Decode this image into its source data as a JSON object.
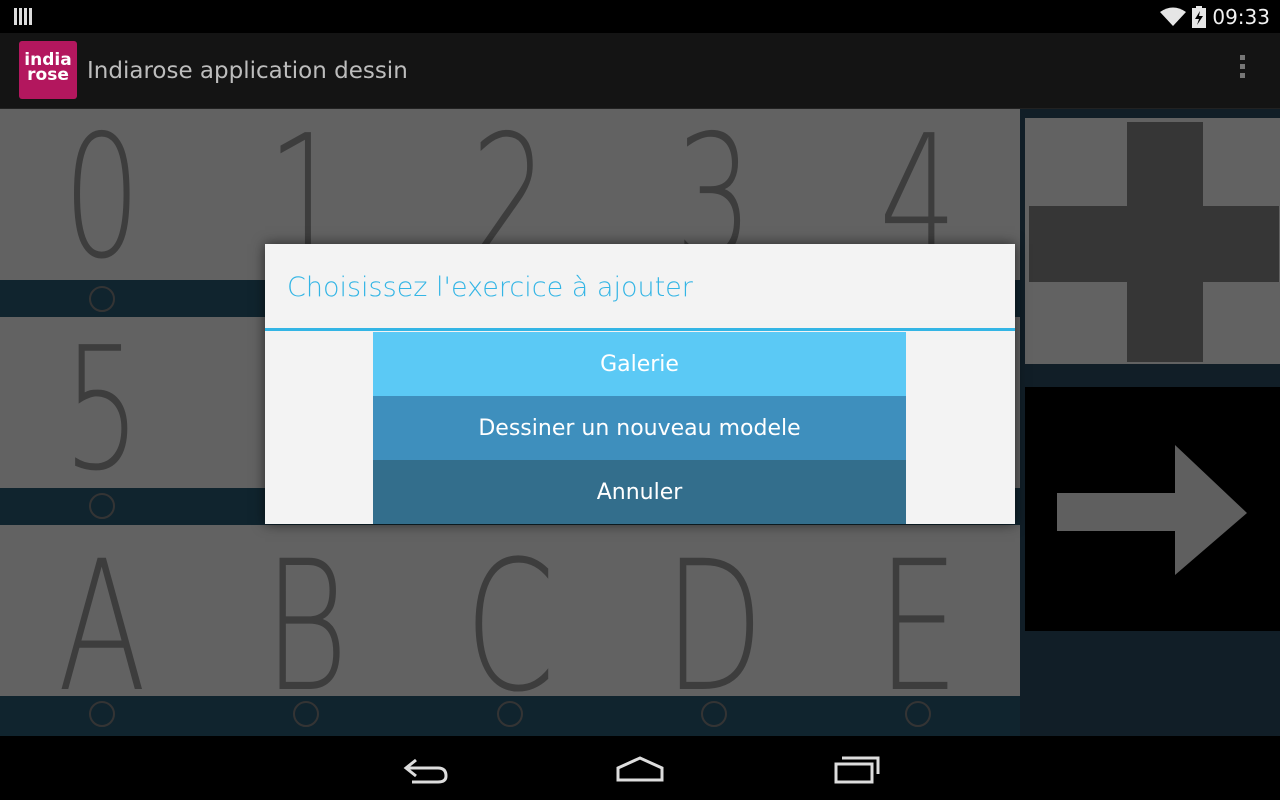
{
  "status_bar": {
    "time": "09:33",
    "icons": [
      "notification-icon",
      "wifi-icon",
      "battery-charging-icon"
    ]
  },
  "action_bar": {
    "app_icon_text_line1": "india",
    "app_icon_text_line2": "rose",
    "title": "Indiarose application dessin",
    "overflow_icon": "overflow-menu-icon"
  },
  "grid": {
    "rows": [
      {
        "items": [
          "0",
          "1",
          "2",
          "3",
          "4"
        ]
      },
      {
        "items": [
          "5",
          "",
          "",
          "",
          ""
        ]
      },
      {
        "items": [
          "A",
          "B",
          "C",
          "D",
          "E"
        ]
      }
    ]
  },
  "right_panel": {
    "add_icon": "plus-icon",
    "next_icon": "arrow-right-icon"
  },
  "dialog": {
    "title": "Choisissez l'exercice à ajouter",
    "buttons": {
      "galerie": "Galerie",
      "dessiner": "Dessiner un nouveau modele",
      "annuler": "Annuler"
    }
  },
  "nav_bar": {
    "icons": [
      "back-icon",
      "home-icon",
      "recent-apps-icon"
    ]
  },
  "colors": {
    "accent": "#33b5e5",
    "app_icon": "#b3175e",
    "btn_galerie": "#5bc9f5",
    "btn_dessiner": "#3e8fbd",
    "btn_annuler": "#336e8c"
  }
}
